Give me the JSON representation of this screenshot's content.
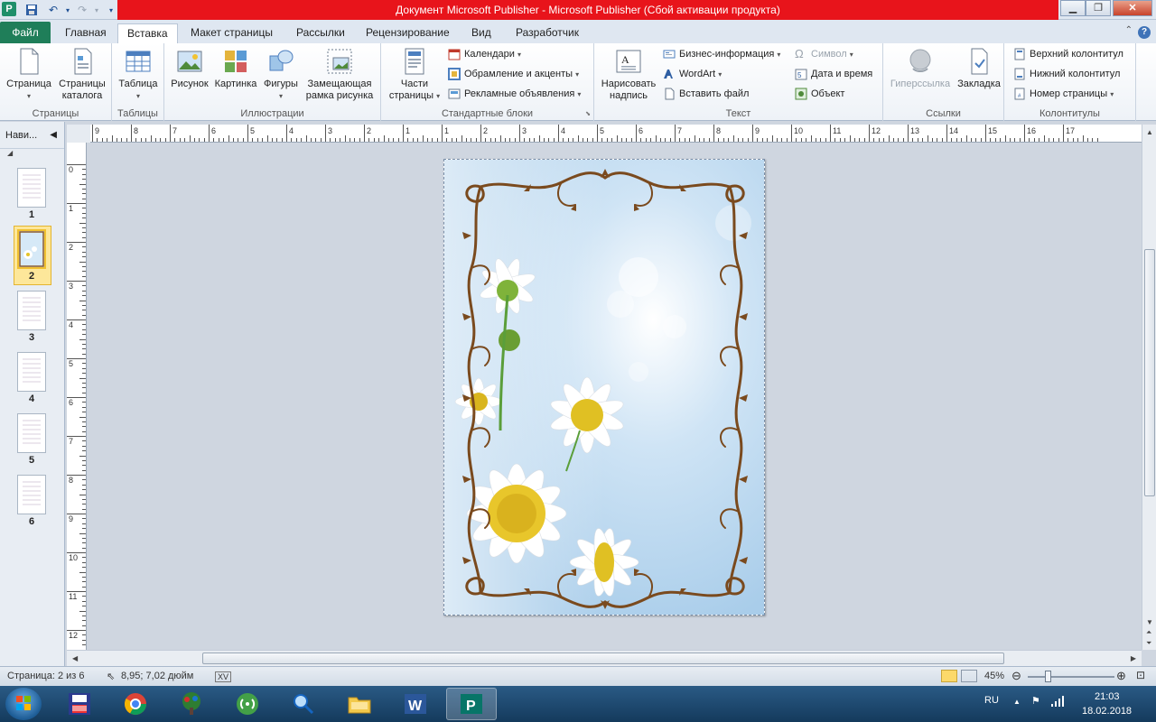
{
  "window": {
    "title": "Документ Microsoft Publisher  -  Microsoft Publisher (Сбой активации продукта)",
    "app_icon": "P"
  },
  "tabs": [
    {
      "label": "Файл"
    },
    {
      "label": "Главная"
    },
    {
      "label": "Вставка"
    },
    {
      "label": "Макет страницы"
    },
    {
      "label": "Рассылки"
    },
    {
      "label": "Рецензирование"
    },
    {
      "label": "Вид"
    },
    {
      "label": "Разработчик"
    }
  ],
  "active_tab": "Вставка",
  "ribbon": {
    "pages": {
      "label": "Страницы",
      "page_btn": "Страница",
      "catalog_btn_line1": "Страницы",
      "catalog_btn_line2": "каталога"
    },
    "tables": {
      "label": "Таблицы",
      "table_btn": "Таблица"
    },
    "illustrations": {
      "label": "Иллюстрации",
      "picture_btn": "Рисунок",
      "clipart_btn": "Картинка",
      "shapes_btn": "Фигуры",
      "placeholder_line1": "Замещающая",
      "placeholder_line2": "рамка рисунка"
    },
    "building_blocks": {
      "label": "Стандартные блоки",
      "parts_line1": "Части",
      "parts_line2": "страницы",
      "calendars": "Календари",
      "borders": "Обрамление и акценты",
      "ads": "Рекламные объявления"
    },
    "text": {
      "label": "Текст",
      "draw_line1": "Нарисовать",
      "draw_line2": "надпись",
      "business_info": "Бизнес-информация",
      "wordart": "WordArt",
      "insert_file": "Вставить файл",
      "symbol": "Символ",
      "date_time": "Дата и время",
      "object": "Объект"
    },
    "links": {
      "label": "Ссылки",
      "hyperlink": "Гиперссылка",
      "bookmark": "Закладка"
    },
    "header_footer": {
      "label": "Колонтитулы",
      "header": "Верхний колонтитул",
      "footer": "Нижний колонтитул",
      "page_number": "Номер страницы"
    }
  },
  "nav": {
    "title": "Нави...",
    "pages": [
      "1",
      "2",
      "3",
      "4",
      "5",
      "6"
    ],
    "selected_page": "2"
  },
  "hruler_labels": [
    "9",
    "8",
    "7",
    "6",
    "5",
    "4",
    "3",
    "2",
    "1",
    "1",
    "2",
    "3",
    "4",
    "5",
    "6",
    "7",
    "8",
    "9",
    "10",
    "11",
    "12",
    "13",
    "14",
    "15",
    "16",
    "17"
  ],
  "vruler_labels": [
    "0",
    "1",
    "2",
    "3",
    "4",
    "5",
    "6",
    "7",
    "8",
    "9",
    "10",
    "11",
    "12"
  ],
  "status": {
    "page": "Страница: 2 из 6",
    "position": "8,95; 7,02 дюйм",
    "zoom": "45%"
  },
  "taskbar": {
    "lang": "RU",
    "time": "21:03",
    "date": "18.02.2018"
  },
  "colors": {
    "title_bar_accent": "#e8141b",
    "file_tab": "#1f7e59",
    "frame_brown": "#7a4a1e"
  },
  "zoom_fraction": 0.45
}
